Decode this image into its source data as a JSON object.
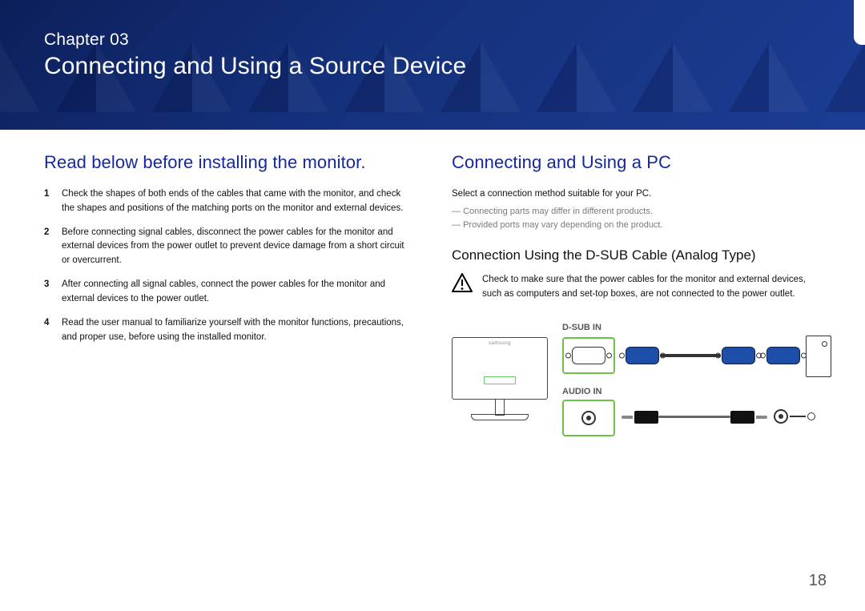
{
  "chapter": {
    "label": "Chapter 03",
    "title": "Connecting and Using a Source Device"
  },
  "left": {
    "heading": "Read below before installing the monitor.",
    "items": [
      "Check the shapes of both ends of the cables that came with the monitor, and check the shapes and positions of the matching ports on the monitor and external devices.",
      "Before connecting signal cables, disconnect the power cables for the monitor and external devices from the power outlet to prevent device damage from a short circuit or overcurrent.",
      "After connecting all signal cables, connect the power cables for the monitor and external devices to the power outlet.",
      "Read the user manual to familiarize yourself with the monitor functions, precautions, and proper use, before using the installed monitor."
    ]
  },
  "right": {
    "heading": "Connecting and Using a PC",
    "intro": "Select a connection method suitable for your PC.",
    "notes": [
      "Connecting parts may differ in different products.",
      "Provided ports may vary depending on the product."
    ],
    "subheading": "Connection Using the D-SUB Cable (Analog Type)",
    "warning": "Check to make sure that the power cables for the monitor and external devices, such as computers and set-top boxes, are not connected to the power outlet.",
    "labels": {
      "dsub": "D-SUB IN",
      "audio": "AUDIO IN"
    }
  },
  "page_number": "18"
}
